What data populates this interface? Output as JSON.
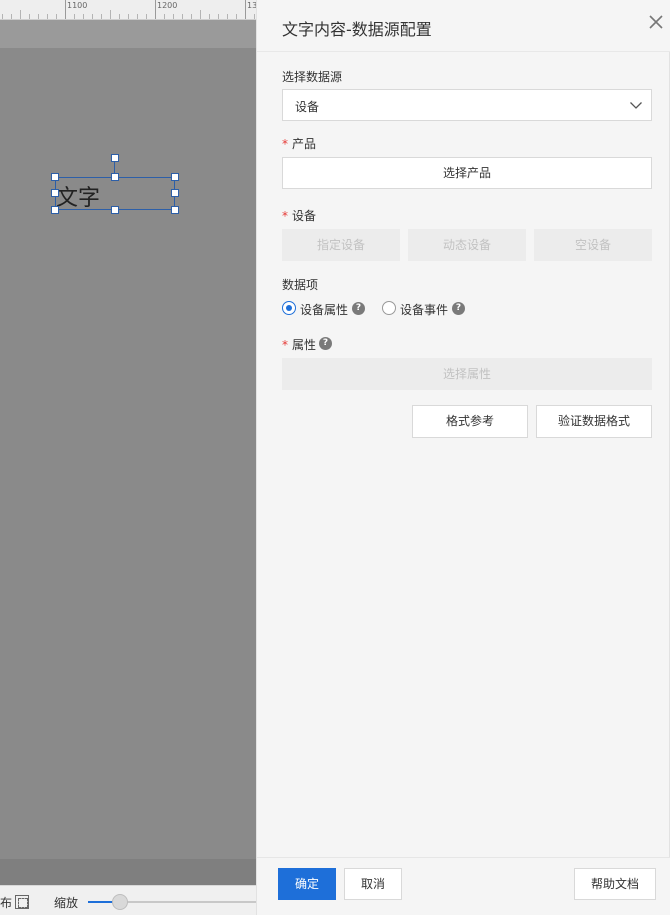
{
  "ruler": {
    "labels": [
      "1100",
      "1200",
      "13"
    ]
  },
  "canvas": {
    "text_widget_text": "文字"
  },
  "status_bar": {
    "layout_label": "布",
    "zoom_label": "缩放"
  },
  "panel": {
    "title": "文字内容-数据源配置",
    "datasource": {
      "label": "选择数据源",
      "value": "设备"
    },
    "product": {
      "label": "产品",
      "button": "选择产品"
    },
    "device": {
      "label": "设备",
      "buttons": [
        "指定设备",
        "动态设备",
        "空设备"
      ]
    },
    "data_item": {
      "label": "数据项",
      "options": [
        {
          "label": "设备属性",
          "checked": true
        },
        {
          "label": "设备事件",
          "checked": false
        }
      ]
    },
    "attribute": {
      "label": "属性",
      "button": "选择属性"
    },
    "format_ref_button": "格式参考",
    "validate_format_button": "验证数据格式",
    "footer": {
      "confirm": "确定",
      "cancel": "取消",
      "help_doc": "帮助文档"
    },
    "required_mark": "*",
    "help_glyph": "?"
  },
  "colors": {
    "primary": "#1e6fd9",
    "required": "#e53935",
    "selection": "#2d5fa8"
  }
}
